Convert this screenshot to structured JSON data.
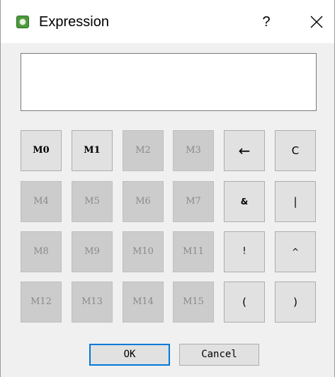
{
  "window": {
    "title": "Expression",
    "help": "?",
    "icon": "app-icon"
  },
  "expression": {
    "value": ""
  },
  "keys": {
    "m0": "M0",
    "m1": "M1",
    "m2": "M2",
    "m3": "M3",
    "m4": "M4",
    "m5": "M5",
    "m6": "M6",
    "m7": "M7",
    "m8": "M8",
    "m9": "M9",
    "m10": "M10",
    "m11": "M11",
    "m12": "M12",
    "m13": "M13",
    "m14": "M14",
    "m15": "M15",
    "backspace": "←",
    "clear": "C",
    "and": "&",
    "or": "|",
    "not": "!",
    "xor": "^",
    "lparen": "(",
    "rparen": ")"
  },
  "buttons": {
    "ok": "OK",
    "cancel": "Cancel"
  },
  "colors": {
    "focus_border": "#0078d7",
    "disabled_text": "#8a8a8a",
    "button_face": "#e1e1e1",
    "disabled_face": "#cccccc"
  }
}
